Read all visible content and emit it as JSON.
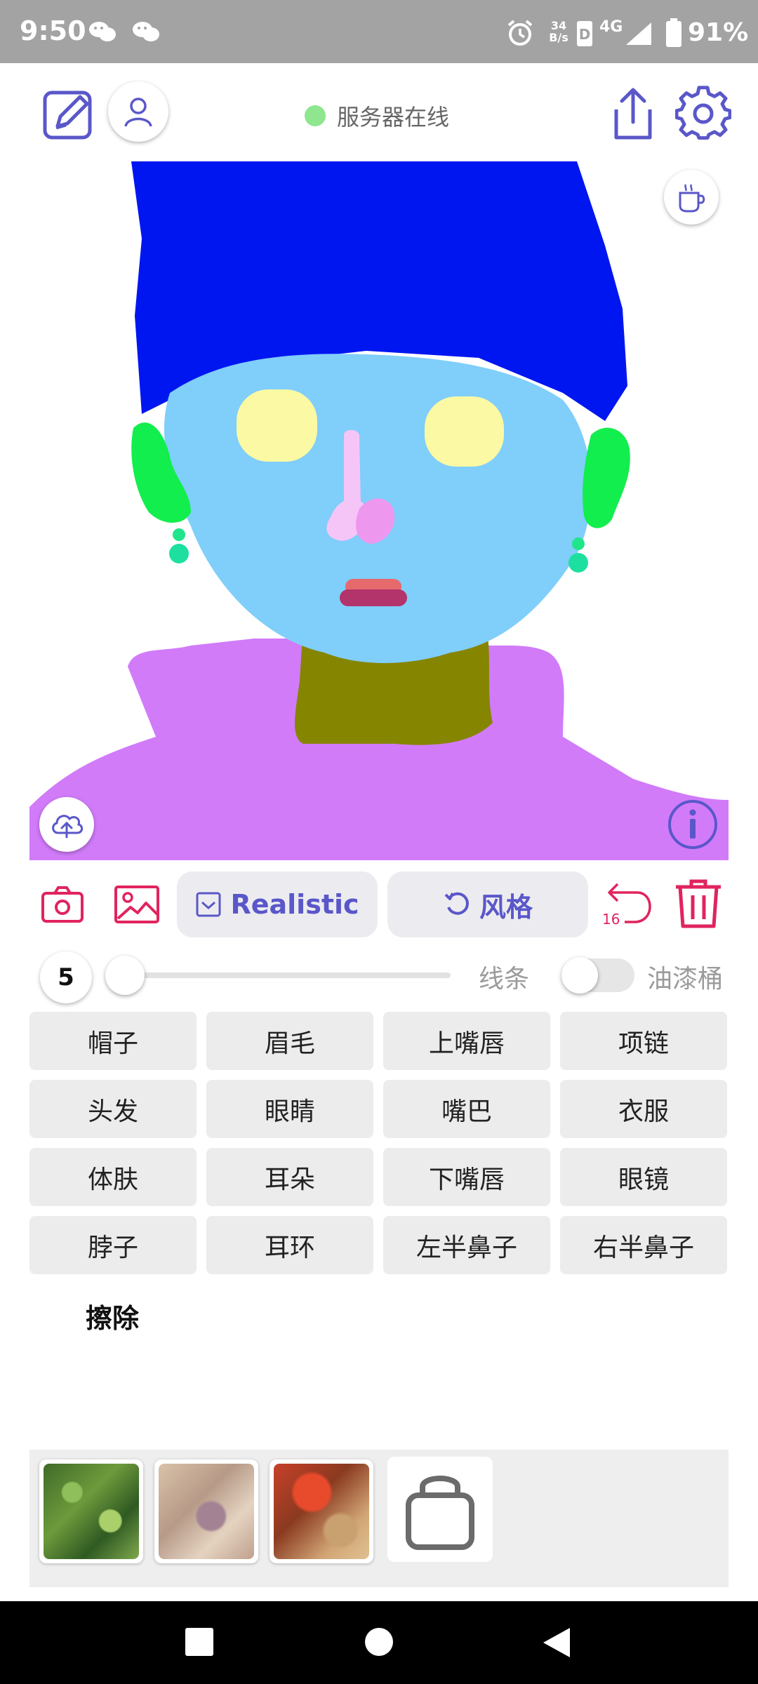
{
  "status_bar": {
    "time": "9:50",
    "net_speed_value": "34",
    "net_speed_unit": "B/s",
    "network": "4G",
    "battery": "91%"
  },
  "header": {
    "server_status": "服务器在线",
    "server_status_color": "#8ee68e",
    "icons": [
      "draw-icon",
      "user-icon",
      "share-icon",
      "settings-icon",
      "coffee-icon"
    ]
  },
  "toolbar": {
    "realistic_label": "Realistic",
    "style_label": "风格",
    "undo_count": "16",
    "accent_color": "#5a57c9",
    "danger_color": "#e0245e"
  },
  "brush": {
    "size": "5",
    "slider_value": 0.0,
    "line_label": "线条",
    "bucket_label": "油漆桶",
    "bucket_enabled": false
  },
  "categories": [
    "帽子",
    "眉毛",
    "上嘴唇",
    "项链",
    "头发",
    "眼睛",
    "嘴巴",
    "衣服",
    "体肤",
    "耳朵",
    "下嘴唇",
    "眼镜",
    "脖子",
    "耳环",
    "左半鼻子",
    "右半鼻子"
  ],
  "erase_label": "擦除",
  "gallery": {
    "thumbnails": [
      "green-texture",
      "beige-texture",
      "red-texture"
    ],
    "last_icon": "bag-icon"
  }
}
